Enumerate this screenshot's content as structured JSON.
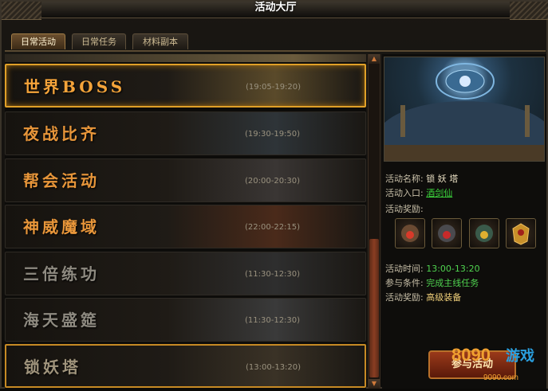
{
  "window": {
    "title": "活动大厅"
  },
  "tabs": [
    {
      "label": "日常活动",
      "active": true
    },
    {
      "label": "日常任务",
      "active": false
    },
    {
      "label": "材料副本",
      "active": false
    }
  ],
  "activities": [
    {
      "name": "世界BOSS",
      "time": "(19:05-19:20)",
      "name_color": "#f5a43a",
      "state": "selected",
      "bg": "#5a4a2a"
    },
    {
      "name": "夜战比齐",
      "time": "(19:30-19:50)",
      "name_color": "#e8963a",
      "state": "normal",
      "bg": "#2e3438"
    },
    {
      "name": "帮会活动",
      "time": "(20:00-20:30)",
      "name_color": "#e8963a",
      "state": "normal",
      "bg": "#3a3634"
    },
    {
      "name": "神威魔域",
      "time": "(22:00-22:15)",
      "name_color": "#e8963a",
      "state": "normal",
      "bg": "#4a2a1a"
    },
    {
      "name": "三倍练功",
      "time": "(11:30-12:30)",
      "name_color": "#8e8a80",
      "state": "normal",
      "bg": "#2e2e2e"
    },
    {
      "name": "海天盛筵",
      "time": "(11:30-12:30)",
      "name_color": "#8e8a80",
      "state": "normal",
      "bg": "#3a3a3a"
    },
    {
      "name": "锁妖塔",
      "time": "(13:00-13:20)",
      "name_color": "#a0947c",
      "state": "highlight",
      "bg": "#3a3226"
    }
  ],
  "detail": {
    "name_label": "活动名称:",
    "name_value": "锁 妖 塔",
    "entry_label": "活动入口:",
    "entry_value": "酒剑仙",
    "rewards_label": "活动奖励:",
    "reward_icons": [
      "demon-mask-icon-red",
      "demon-mask-icon-dark",
      "demon-mask-icon-blue",
      "gold-armor-icon"
    ],
    "time_label": "活动时间:",
    "time_value": "13:00-13:20",
    "condition_label": "参与条件:",
    "condition_value": "完成主线任务",
    "reward2_label": "活动奖励:",
    "reward2_value": "高级装备",
    "action_button": "参与活动"
  },
  "watermark": {
    "number": "8090",
    "text": "游戏",
    "domain": "9090.com"
  },
  "colors": {
    "accent": "#e0a028",
    "link_green": "#3bd33b",
    "tab_active": "#6b4f2e"
  }
}
